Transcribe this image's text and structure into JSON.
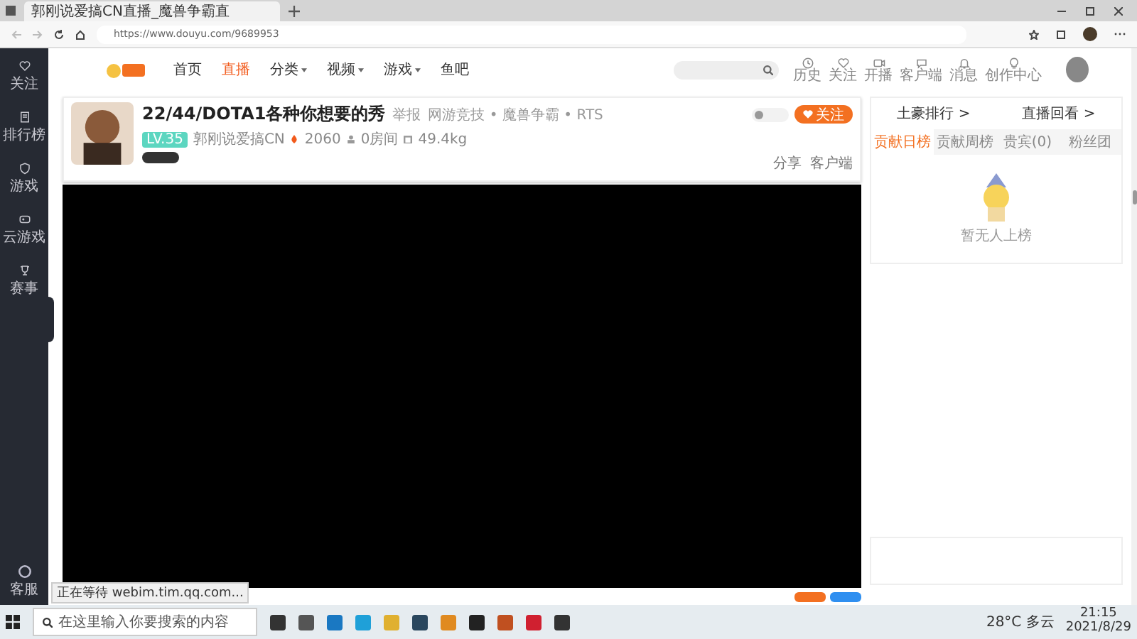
{
  "browser": {
    "tab_title": "郭刚说爱搞CN直播_魔兽争霸直",
    "url": "https://www.douyu.com/9689953",
    "status": "正在等待 webim.tim.qq.com..."
  },
  "site_nav": [
    {
      "label": "首页",
      "selected": false,
      "dropdown": false
    },
    {
      "label": "直播",
      "selected": true,
      "dropdown": false
    },
    {
      "label": "分类",
      "selected": false,
      "dropdown": true
    },
    {
      "label": "视频",
      "selected": false,
      "dropdown": true
    },
    {
      "label": "游戏",
      "selected": false,
      "dropdown": true
    },
    {
      "label": "鱼吧",
      "selected": false,
      "dropdown": false
    }
  ],
  "header_actions": [
    {
      "label": "历史",
      "kind": "clock"
    },
    {
      "label": "关注",
      "kind": "heart"
    },
    {
      "label": "开播",
      "kind": "camera"
    },
    {
      "label": "客户端",
      "kind": "chat"
    },
    {
      "label": "消息",
      "kind": "bell"
    },
    {
      "label": "创作中心",
      "kind": "bulb"
    }
  ],
  "sidebar": [
    {
      "label": "关注",
      "kind": "heart"
    },
    {
      "label": "排行榜",
      "kind": "list"
    },
    {
      "label": "游戏",
      "kind": "shield"
    },
    {
      "label": "云游戏",
      "kind": "gamepad"
    },
    {
      "label": "赛事",
      "kind": "trophy"
    }
  ],
  "sidebar_bottom": {
    "label": "客服"
  },
  "room": {
    "title": "22/44/DOTA1各种你想要的秀",
    "report": "举报",
    "category": "网游竞技 • 魔兽争霸 • RTS",
    "level_badge": "LV.35",
    "streamer": "郭刚说爱搞CN",
    "heat": "2060",
    "rooms": "0房间",
    "weight": "49.4kg",
    "toggle_on": false,
    "follow": "关注",
    "share": "分享",
    "client": "客户端"
  },
  "ranking": {
    "links": [
      "土豪排行 >",
      "直播回看 >"
    ],
    "tabs": [
      {
        "label": "贡献日榜",
        "selected": true
      },
      {
        "label": "贡献周榜",
        "selected": false
      },
      {
        "label": "贵宾(0)",
        "selected": false
      },
      {
        "label": "粉丝团",
        "selected": false
      }
    ],
    "empty": "暂无人上榜"
  },
  "taskbar": {
    "search_placeholder": "在这里输入你要搜索的内容",
    "weather": "28°C 多云",
    "time": "21:15",
    "date": "2021/8/29"
  }
}
